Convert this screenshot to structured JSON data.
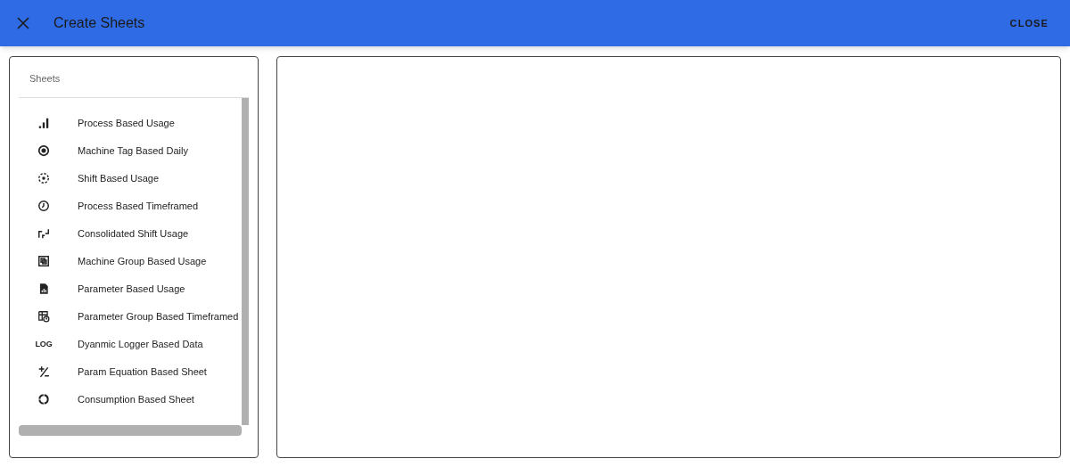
{
  "dialog": {
    "title": "Create Sheets",
    "close_button": "CLOSE"
  },
  "sheets": {
    "heading": "Sheets",
    "items": [
      {
        "kind": "bars",
        "label": "Process Based Usage"
      },
      {
        "kind": "target",
        "label": "Machine Tag Based Daily"
      },
      {
        "kind": "dashed",
        "label": "Shift Based Usage"
      },
      {
        "kind": "clock",
        "label": "Process Based Timeframed"
      },
      {
        "kind": "arrows",
        "label": "Consolidated Shift Usage"
      },
      {
        "kind": "group",
        "label": "Machine Group Based Usage"
      },
      {
        "kind": "file",
        "label": "Parameter Based Usage"
      },
      {
        "kind": "table",
        "label": "Parameter Group Based Timeframed"
      },
      {
        "kind": "text",
        "icon_text": "LOG",
        "label": "Dyanmic Logger Based Data"
      },
      {
        "kind": "equation",
        "label": "Param Equation Based Sheet"
      },
      {
        "kind": "ring",
        "label": "Consumption Based Sheet"
      }
    ]
  }
}
